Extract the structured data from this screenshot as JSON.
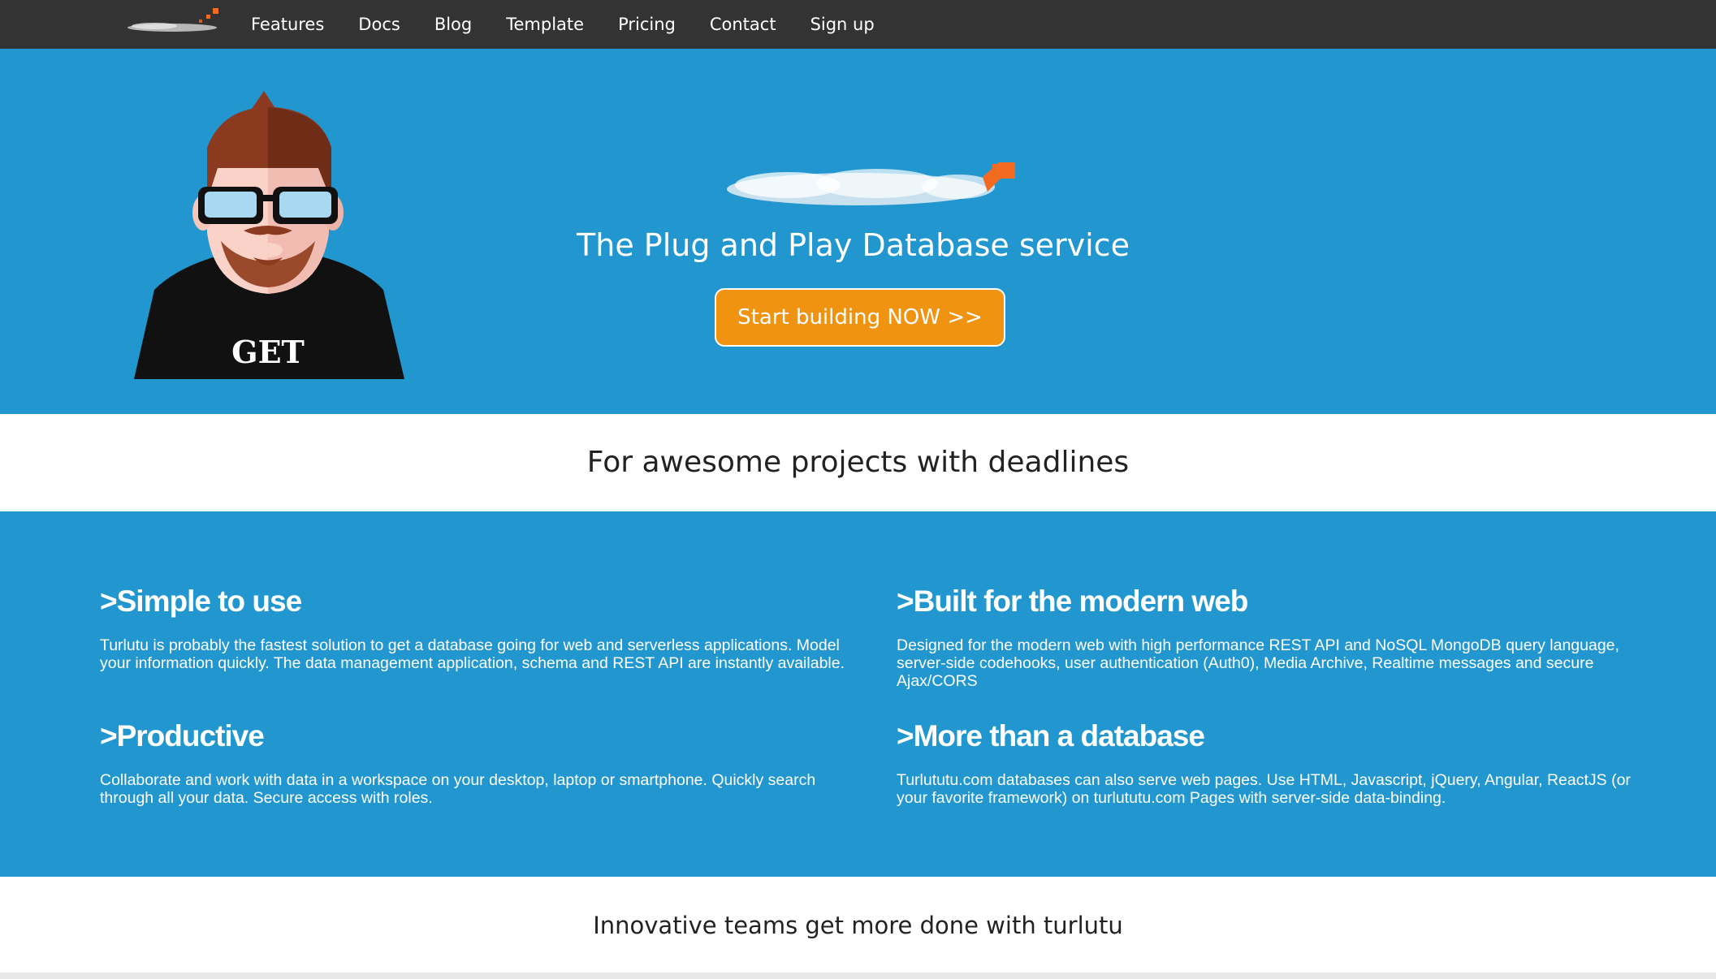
{
  "nav": {
    "links": [
      "Features",
      "Docs",
      "Blog",
      "Template",
      "Pricing",
      "Contact",
      "Sign up"
    ]
  },
  "hero": {
    "tagline": "The Plug and Play Database service",
    "cta_label": "Start building NOW >>",
    "mascot_shirt_text": "GET"
  },
  "band1": {
    "text": "For awesome projects with deadlines"
  },
  "features": [
    {
      "title": ">Simple to use",
      "body": "Turlutu is probably the fastest solution to get a database going for web and serverless applications. Model your information quickly. The data management application, schema and REST API are instantly available."
    },
    {
      "title": ">Built for the modern web",
      "body": "Designed for the modern web with high performance REST API and NoSQL MongoDB query language, server-side codehooks, user authentication (Auth0), Media Archive, Realtime messages and secure Ajax/CORS"
    },
    {
      "title": ">Productive",
      "body": "Collaborate and work with data in a workspace on your desktop, laptop or smartphone. Quickly search through all your data. Secure access with roles."
    },
    {
      "title": ">More than a database",
      "body": "Turlututu.com databases can also serve web pages. Use HTML, Javascript, jQuery, Angular, ReactJS (or your favorite framework) on turlututu.com Pages with server-side data-binding."
    }
  ],
  "band2": {
    "text": "Innovative teams get more done with turlutu"
  },
  "colors": {
    "nav_bg": "#333333",
    "brand_blue": "#2196cf",
    "cta_orange": "#ef9311",
    "logo_accent": "#f26b21"
  },
  "icons": [
    "brand-logo-icon",
    "mascot-illustration"
  ]
}
